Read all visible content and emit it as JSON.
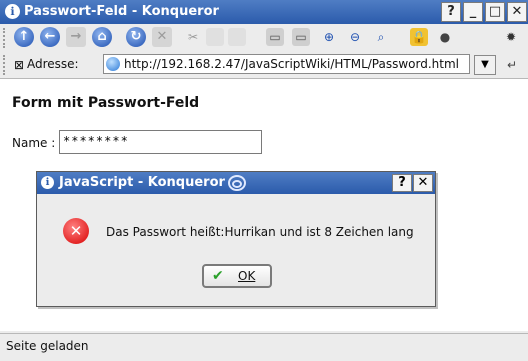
{
  "window": {
    "title": "Passwort-Feld - Konqueror",
    "app_icon": "konqueror-icon",
    "help_glyph": "?",
    "minimize_glyph": "_",
    "maximize_glyph": "□",
    "close_glyph": "✕"
  },
  "toolbar": {
    "icons": [
      "up-arrow-icon",
      "back-icon",
      "forward-icon",
      "home-icon",
      "reload-icon",
      "stop-icon",
      "cut-icon",
      "copy-icon",
      "paste-icon",
      "print-icon",
      "print-frame-icon",
      "zoom-in-icon",
      "zoom-out-icon",
      "zoom-icon",
      "lock-icon",
      "download-icon",
      "kde-gear-icon"
    ]
  },
  "location": {
    "label": "Adresse:",
    "url": "http://192.168.2.47/JavaScriptWiki/HTML/Password.html"
  },
  "page": {
    "heading": "Form mit Passwort-Feld",
    "name_label": "Name :",
    "password_value": "********"
  },
  "dialog": {
    "title": "JavaScript - Konqueror",
    "help_glyph": "?",
    "close_glyph": "✕",
    "message": "Das Passwort heißt:Hurrikan und ist 8 Zeichen lang",
    "ok_label": "OK",
    "error_glyph": "✕"
  },
  "status": {
    "text": "Seite geladen"
  }
}
